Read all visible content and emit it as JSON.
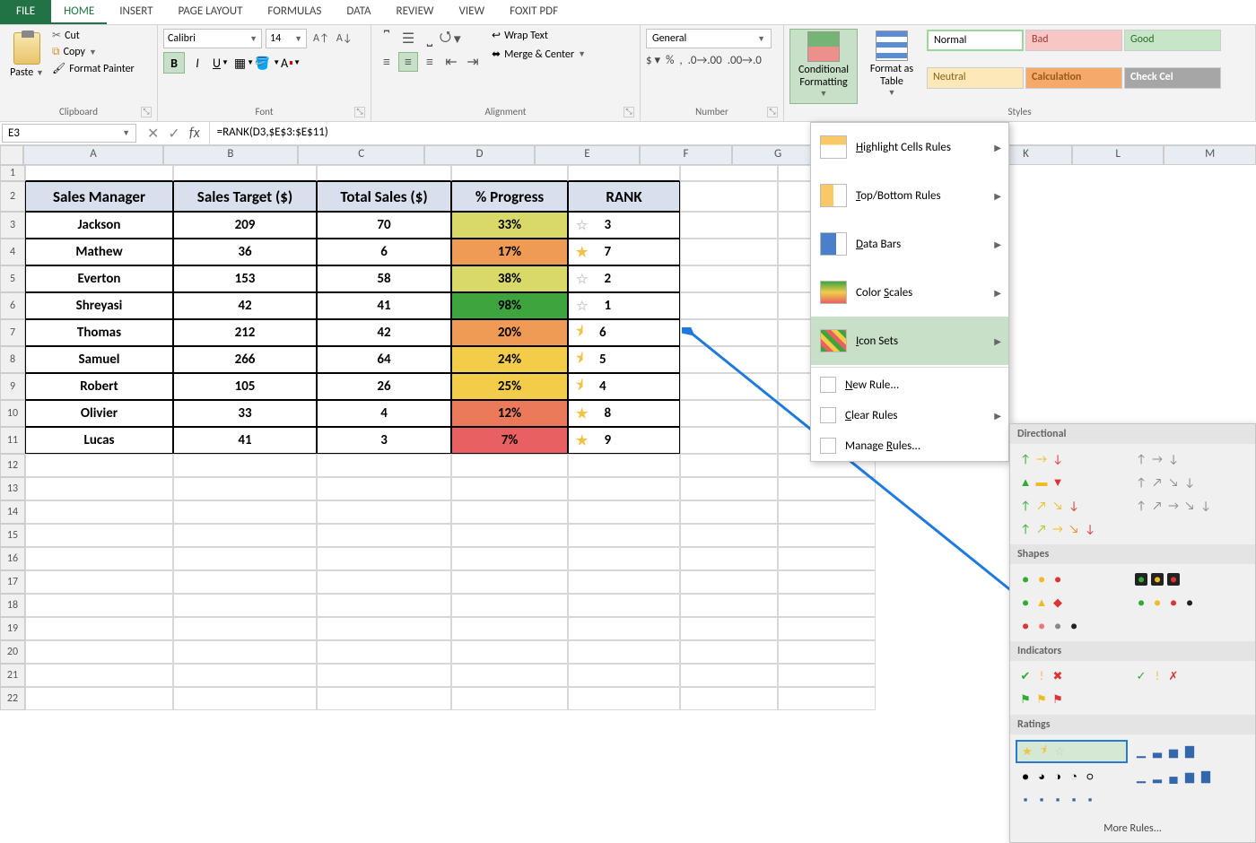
{
  "tabs": {
    "file": "FILE",
    "list": [
      "HOME",
      "INSERT",
      "PAGE LAYOUT",
      "FORMULAS",
      "DATA",
      "REVIEW",
      "VIEW",
      "FOXIT PDF"
    ],
    "active": "HOME"
  },
  "clipboard": {
    "paste": "Paste",
    "cut": "Cut",
    "copy": "Copy",
    "format_painter": "Format Painter",
    "group": "Clipboard"
  },
  "font": {
    "name": "Calibri",
    "size": "14",
    "group": "Font"
  },
  "alignment": {
    "wrap": "Wrap Text",
    "merge": "Merge & Center",
    "group": "Alignment"
  },
  "number": {
    "format": "General",
    "group": "Number"
  },
  "styles": {
    "cond_fmt": "Conditional Formatting",
    "fmt_table": "Format as Table",
    "normal": "Normal",
    "bad": "Bad",
    "good": "Good",
    "neutral": "Neutral",
    "calculation": "Calculation",
    "check_cell": "Check Cel",
    "group": "Styles"
  },
  "name_box": "E3",
  "formula": "=RANK(D3,$E$3:$E$11)",
  "columns": [
    "A",
    "B",
    "C",
    "D",
    "E",
    "F",
    "G",
    "K",
    "L",
    "M"
  ],
  "headers": [
    "Sales Manager",
    "Sales Target ($)",
    "Total Sales ($)",
    "% Progress",
    "RANK"
  ],
  "rows": [
    {
      "mgr": "Jackson",
      "target": "209",
      "sales": "70",
      "pct": "33%",
      "pct_bg": "#d9d96a",
      "star": "empty",
      "rank": "3"
    },
    {
      "mgr": "Mathew",
      "target": "36",
      "sales": "6",
      "pct": "17%",
      "pct_bg": "#ef9b54",
      "star": "gold",
      "rank": "7"
    },
    {
      "mgr": "Everton",
      "target": "153",
      "sales": "58",
      "pct": "38%",
      "pct_bg": "#d9d96a",
      "star": "empty",
      "rank": "2"
    },
    {
      "mgr": "Shreyasi",
      "target": "42",
      "sales": "41",
      "pct": "98%",
      "pct_bg": "#3ea43e",
      "star": "empty",
      "rank": "1"
    },
    {
      "mgr": "Thomas",
      "target": "212",
      "sales": "42",
      "pct": "20%",
      "pct_bg": "#ef9b54",
      "star": "half",
      "rank": "6"
    },
    {
      "mgr": "Samuel",
      "target": "266",
      "sales": "64",
      "pct": "24%",
      "pct_bg": "#f3cd4a",
      "star": "half",
      "rank": "5"
    },
    {
      "mgr": "Robert",
      "target": "105",
      "sales": "26",
      "pct": "25%",
      "pct_bg": "#f3cd4a",
      "star": "half",
      "rank": "4"
    },
    {
      "mgr": "Olivier",
      "target": "33",
      "sales": "4",
      "pct": "12%",
      "pct_bg": "#ea7a59",
      "star": "gold",
      "rank": "8"
    },
    {
      "mgr": "Lucas",
      "target": "41",
      "sales": "3",
      "pct": "7%",
      "pct_bg": "#e86060",
      "star": "gold",
      "rank": "9"
    }
  ],
  "cf_menu": {
    "highlight": "Highlight Cells Rules",
    "topbottom": "Top/Bottom Rules",
    "databars": "Data Bars",
    "colorscales": "Color Scales",
    "iconsets": "Icon Sets",
    "newrule": "New Rule...",
    "clear": "Clear Rules",
    "manage": "Manage Rules..."
  },
  "icon_submenu": {
    "directional": "Directional",
    "shapes": "Shapes",
    "indicators": "Indicators",
    "ratings": "Ratings",
    "more": "More Rules..."
  }
}
